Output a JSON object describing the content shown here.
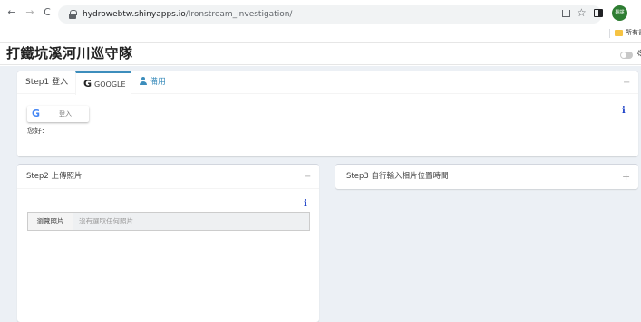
{
  "browser": {
    "url_host": "hydrowebtw.shinyapps.io",
    "url_path": "/Ironstream_investigation/",
    "bookmark_label": "所有書",
    "avatar_text": "翻譯"
  },
  "app": {
    "title": "打鐵坑溪河川巡守隊"
  },
  "box1": {
    "tab_step1": "Step1 登入",
    "tab_google_letter": "G",
    "tab_google": "GOOGLE",
    "tab_backup": "備用",
    "signin_label": "登入",
    "greeting": "您好:",
    "info": "i",
    "collapse": "−"
  },
  "box2": {
    "title": "Step2 上傳照片",
    "collapse": "−",
    "info": "i",
    "browse_label": "瀏覽照片",
    "file_placeholder": "沒有選取任何照片"
  },
  "box3": {
    "title": "Step3 自行輸入相片位置時間",
    "collapse": "+"
  },
  "colors": {
    "accent": "#3c8dbc",
    "content_bg": "#ecf0f5",
    "info_icon": "#1a3fc7"
  }
}
